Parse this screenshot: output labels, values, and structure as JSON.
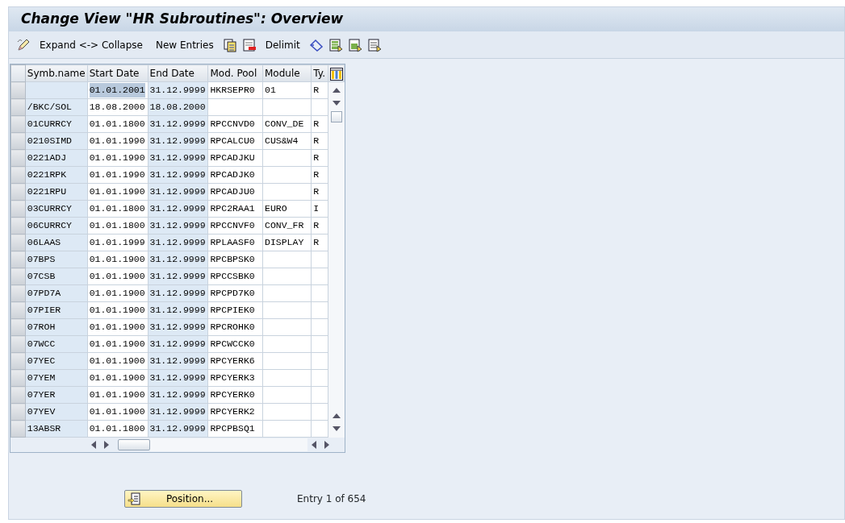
{
  "window": {
    "title": "Change View \"HR Subroutines\": Overview"
  },
  "toolbar": [
    {
      "kind": "icon"
    },
    {
      "kind": "text",
      "label": "Expand <-> Collapse"
    },
    {
      "kind": "text",
      "label": "New Entries"
    },
    {
      "kind": "icon"
    },
    {
      "kind": "icon"
    },
    {
      "kind": "text",
      "label": "Delimit"
    },
    {
      "kind": "icon"
    },
    {
      "kind": "icon"
    },
    {
      "kind": "icon"
    },
    {
      "kind": "icon"
    }
  ],
  "table": {
    "columns": [
      "Symb.name",
      "Start Date",
      "End Date",
      "Mod. Pool",
      "Module",
      "Ty."
    ],
    "rows": [
      {
        "cells": [
          "",
          "01.01.2001",
          "31.12.9999",
          "HKRSEPR0",
          "01",
          "R"
        ],
        "focused": true
      },
      {
        "cells": [
          "/BKC/SOL",
          "18.08.2000",
          "18.08.2000",
          "",
          "",
          ""
        ],
        "focused": false
      },
      {
        "cells": [
          "01CURRCY",
          "01.01.1800",
          "31.12.9999",
          "RPCCNVD0",
          "CONV_DE",
          "R"
        ],
        "focused": false
      },
      {
        "cells": [
          "0210SIMD",
          "01.01.1990",
          "31.12.9999",
          "RPCALCU0",
          "CUS&W4",
          "R"
        ],
        "focused": false
      },
      {
        "cells": [
          "0221ADJ",
          "01.01.1990",
          "31.12.9999",
          "RPCADJKU",
          "",
          "R"
        ],
        "focused": false
      },
      {
        "cells": [
          "0221RPK",
          "01.01.1990",
          "31.12.9999",
          "RPCADJK0",
          "",
          "R"
        ],
        "focused": false
      },
      {
        "cells": [
          "0221RPU",
          "01.01.1990",
          "31.12.9999",
          "RPCADJU0",
          "",
          "R"
        ],
        "focused": false
      },
      {
        "cells": [
          "03CURRCY",
          "01.01.1800",
          "31.12.9999",
          "RPC2RAA1",
          "EURO",
          "I"
        ],
        "focused": false
      },
      {
        "cells": [
          "06CURRCY",
          "01.01.1800",
          "31.12.9999",
          "RPCCNVF0",
          "CONV_FR",
          "R"
        ],
        "focused": false
      },
      {
        "cells": [
          "06LAAS",
          "01.01.1999",
          "31.12.9999",
          "RPLAASF0",
          "DISPLAY",
          "R"
        ],
        "focused": false
      },
      {
        "cells": [
          "07BPS",
          "01.01.1900",
          "31.12.9999",
          "RPCBPSK0",
          "",
          ""
        ],
        "focused": false
      },
      {
        "cells": [
          "07CSB",
          "01.01.1900",
          "31.12.9999",
          "RPCCSBK0",
          "",
          ""
        ],
        "focused": false
      },
      {
        "cells": [
          "07PD7A",
          "01.01.1900",
          "31.12.9999",
          "RPCPD7K0",
          "",
          ""
        ],
        "focused": false
      },
      {
        "cells": [
          "07PIER",
          "01.01.1900",
          "31.12.9999",
          "RPCPIEK0",
          "",
          ""
        ],
        "focused": false
      },
      {
        "cells": [
          "07ROH",
          "01.01.1900",
          "31.12.9999",
          "RPCROHK0",
          "",
          ""
        ],
        "focused": false
      },
      {
        "cells": [
          "07WCC",
          "01.01.1900",
          "31.12.9999",
          "RPCWCCK0",
          "",
          ""
        ],
        "focused": false
      },
      {
        "cells": [
          "07YEC",
          "01.01.1900",
          "31.12.9999",
          "RPCYERK6",
          "",
          ""
        ],
        "focused": false
      },
      {
        "cells": [
          "07YEM",
          "01.01.1900",
          "31.12.9999",
          "RPCYERK3",
          "",
          ""
        ],
        "focused": false
      },
      {
        "cells": [
          "07YER",
          "01.01.1900",
          "31.12.9999",
          "RPCYERK0",
          "",
          ""
        ],
        "focused": false
      },
      {
        "cells": [
          "07YEV",
          "01.01.1900",
          "31.12.9999",
          "RPCYERK2",
          "",
          ""
        ],
        "focused": false
      },
      {
        "cells": [
          "13ABSR",
          "01.01.1800",
          "31.12.9999",
          "RPCPBSQ1",
          "",
          ""
        ],
        "focused": false
      }
    ]
  },
  "footer": {
    "button": "Position...",
    "entry_info": "Entry 1 of 654"
  }
}
